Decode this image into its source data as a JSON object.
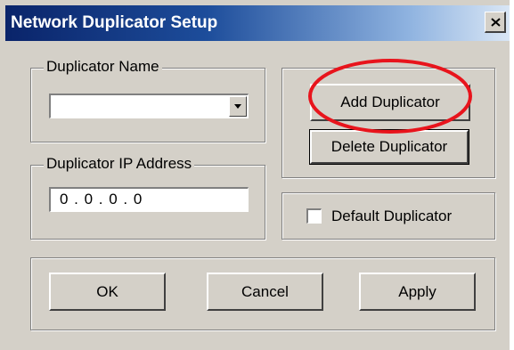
{
  "window": {
    "title": "Network Duplicator Setup",
    "close_symbol": "×"
  },
  "duplicator_name": {
    "group_label": "Duplicator Name",
    "selected_value": ""
  },
  "ip_address": {
    "group_label": "Duplicator IP Address",
    "value": "0 . 0 . 0 . 0"
  },
  "actions": {
    "add_label": "Add Duplicator",
    "delete_label": "Delete Duplicator",
    "default_label": "Default Duplicator",
    "default_checked": false
  },
  "footer": {
    "ok_label": "OK",
    "cancel_label": "Cancel",
    "apply_label": "Apply"
  },
  "colors": {
    "dialog_face": "#d4d0c8",
    "title_start": "#0a246a",
    "annotation_red": "#e8141c"
  },
  "icons": {
    "close": "close-icon",
    "dropdown": "chevron-down-icon"
  }
}
